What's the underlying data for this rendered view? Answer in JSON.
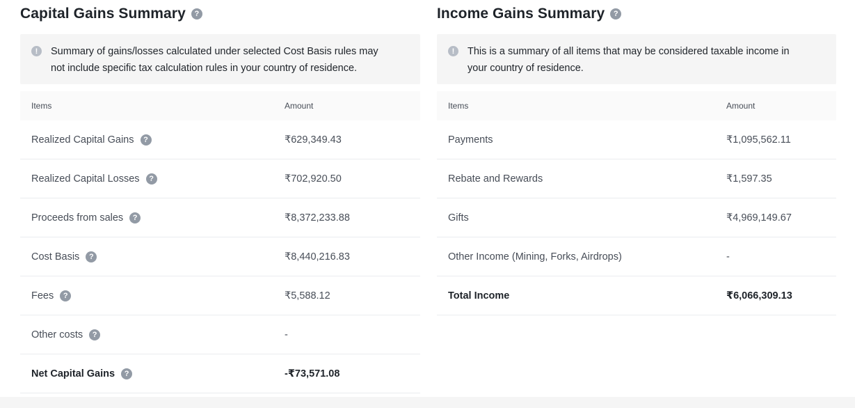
{
  "capital": {
    "title": "Capital Gains Summary",
    "notice": "Summary of gains/losses calculated under selected Cost Basis rules may not include specific tax calculation rules in your country of residence.",
    "col_items": "Items",
    "col_amount": "Amount",
    "rows": [
      {
        "label": "Realized Capital Gains",
        "value": "₹629,349.43"
      },
      {
        "label": "Realized Capital Losses",
        "value": "₹702,920.50"
      },
      {
        "label": "Proceeds from sales",
        "value": "₹8,372,233.88"
      },
      {
        "label": "Cost Basis",
        "value": "₹8,440,216.83"
      },
      {
        "label": "Fees",
        "value": "₹5,588.12"
      },
      {
        "label": "Other costs",
        "value": "-"
      },
      {
        "label": "Net Capital Gains",
        "value": "-₹73,571.08"
      }
    ]
  },
  "income": {
    "title": "Income Gains Summary",
    "notice": "This is a summary of all items that may be considered taxable income in your country of residence.",
    "col_items": "Items",
    "col_amount": "Amount",
    "rows": [
      {
        "label": "Payments",
        "value": "₹1,095,562.11"
      },
      {
        "label": "Rebate and Rewards",
        "value": "₹1,597.35"
      },
      {
        "label": "Gifts",
        "value": "₹4,969,149.67"
      },
      {
        "label": "Other Income (Mining, Forks, Airdrops)",
        "value": "-"
      },
      {
        "label": "Total Income",
        "value": "₹6,066,309.13"
      }
    ]
  },
  "icons": {
    "help": "?",
    "info": "!"
  }
}
